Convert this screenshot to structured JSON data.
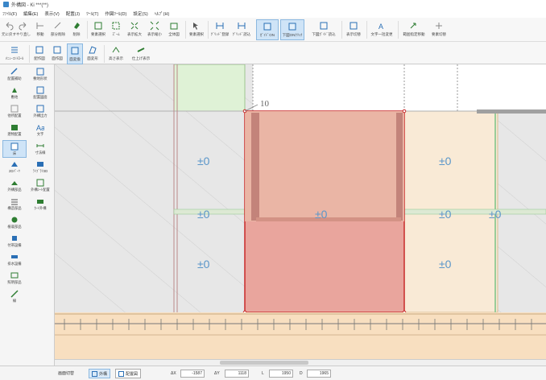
{
  "title_bar": {
    "text": "外構図 - Ki ***(**)"
  },
  "menu": [
    "ﾌｧｲﾙ(F)",
    "編集(E)",
    "表示(V)",
    "配置(J)",
    "ﾂｰﾙ(T)",
    "作図ﾂｰﾙ(D)",
    "設定(S)",
    "ﾍﾙﾌﾟ(H)"
  ],
  "ribbon": {
    "buttons": [
      {
        "label": "元に戻す",
        "icon": "undo-icon"
      },
      {
        "label": "やり直し",
        "icon": "redo-icon"
      },
      {
        "label": "移動",
        "icon": "move-icon"
      },
      {
        "label": "部分削除",
        "icon": "partial-delete-icon"
      },
      {
        "label": "削除",
        "icon": "eraser-icon"
      },
      {
        "label": "要素選択",
        "icon": "element-select-icon"
      },
      {
        "label": "ｽﾞｰﾑ",
        "icon": "zoom-icon"
      },
      {
        "label": "表示拡大",
        "icon": "zoom-in-icon"
      },
      {
        "label": "表示縮小",
        "icon": "zoom-out-icon"
      },
      {
        "label": "全体図",
        "icon": "fit-all-icon"
      },
      {
        "label": "要素選択",
        "icon": "cursor-icon"
      },
      {
        "label": "ｸﾞﾘｯﾄﾞ登録",
        "icon": "grid-register-icon"
      },
      {
        "label": "ｸﾞﾘｯﾄﾞ読込",
        "icon": "grid-load-icon"
      },
      {
        "label": "ｶﾞｲﾄﾞON",
        "icon": "guide-on-icon"
      },
      {
        "label": "下図ONｸﾘｯｸ",
        "icon": "underlay-on-icon"
      },
      {
        "label": "下図ｶﾞｲﾄﾞ読込",
        "icon": "underlay-load-icon"
      },
      {
        "label": "表示切替",
        "icon": "display-toggle-icon"
      },
      {
        "label": "文字一括変更",
        "icon": "text-change-icon"
      },
      {
        "label": "範囲指定移動",
        "icon": "range-move-icon"
      },
      {
        "label": "要素切替",
        "icon": "element-toggle-icon"
      }
    ]
  },
  "toolbar2": {
    "buttons": [
      {
        "label": "ﾒﾆｭｰｺﾝﾄﾛｰﾙ",
        "icon": "menu-control-icon"
      },
      {
        "label": "配作図",
        "icon": "layout-icon"
      },
      {
        "label": "面作図",
        "icon": "plane-icon"
      },
      {
        "label": "面変換",
        "icon": "plane-convert-icon"
      },
      {
        "label": "面変形",
        "icon": "plane-deform-icon"
      },
      {
        "label": "高さ表示",
        "icon": "height-display-icon"
      },
      {
        "label": "仕上げ表示",
        "icon": "finish-display-icon"
      }
    ]
  },
  "left_panel": {
    "items": [
      {
        "label": "配置補助",
        "icon": "placement-assist-icon"
      },
      {
        "label": "敷地形状",
        "icon": "site-shape-icon"
      },
      {
        "label": "敷地",
        "icon": "site-icon"
      },
      {
        "label": "配置図面",
        "icon": "plan-drawing-icon"
      },
      {
        "label": "他所配置",
        "icon": "other-placement-icon"
      },
      {
        "label": "外構出力",
        "icon": "output-icon"
      },
      {
        "label": "建物配置",
        "icon": "building-icon"
      },
      {
        "label": "文字",
        "icon": "text-icon"
      },
      {
        "label": "床",
        "icon": "floor-icon"
      },
      {
        "label": "寸法線",
        "icon": "dimension-icon"
      },
      {
        "label": "2Dﾊﾟｰﾂ",
        "icon": "parts-2d-icon"
      },
      {
        "label": "ﾗｲﾌﾞﾗﾘ3D",
        "icon": "library-3d-icon"
      },
      {
        "label": "外構部品",
        "icon": "exterior-parts-icon"
      },
      {
        "label": "外構ｼｰﾄ配置",
        "icon": "sheet-icon"
      },
      {
        "label": "構造部品",
        "icon": "structure-icon"
      },
      {
        "label": "ｶｰﾄ外構",
        "icon": "carport-icon"
      },
      {
        "label": "植栽部品",
        "icon": "plant-icon"
      },
      {
        "label": "付帯設備",
        "icon": "equipment-icon"
      },
      {
        "label": "排水設備",
        "icon": "drain-icon"
      },
      {
        "label": "照明部品",
        "icon": "light-icon"
      },
      {
        "label": "線",
        "icon": "line-icon"
      }
    ]
  },
  "canvas": {
    "level_labels": [
      "±0",
      "±0",
      "±0",
      "±0",
      "±0",
      "±0",
      "±0",
      "±0"
    ],
    "dimension_label": "10",
    "colors": {
      "selection": "#e9a59d",
      "selection_border": "#c82a2a",
      "beige": "#f9ead6",
      "green": "#dff2d6",
      "fence": "#f8dfc0"
    }
  },
  "status_bar": {
    "fields": [
      {
        "label": "画面切替",
        "value": ""
      },
      {
        "label": "外構",
        "value": ""
      },
      {
        "label": "配置図",
        "value": ""
      },
      {
        "label": "ΔX",
        "value": "-1587"
      },
      {
        "label": "ΔY",
        "value": "1118"
      },
      {
        "label": "L",
        "value": "1950"
      },
      {
        "label": "D",
        "value": "1965"
      }
    ]
  }
}
